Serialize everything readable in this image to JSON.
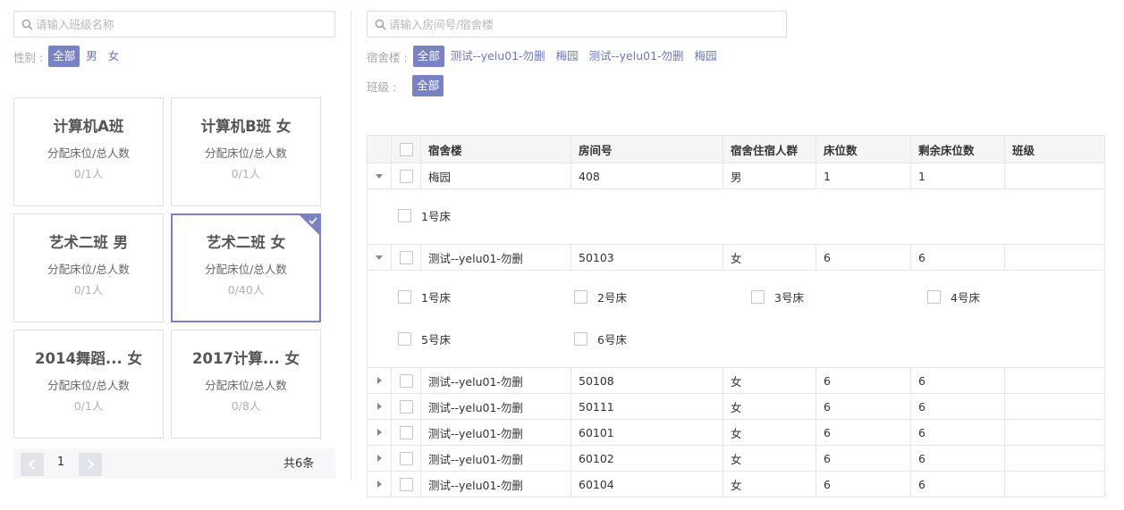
{
  "class_panel": {
    "search_placeholder": "请输入班级名称",
    "gender_label": "性别 :",
    "gender_options": [
      "全部",
      "男",
      "女"
    ],
    "classes": [
      {
        "name": "计算机A班",
        "sub": "分配床位/总人数",
        "count": "0/1人"
      },
      {
        "name": "计算机B班 女",
        "sub": "分配床位/总人数",
        "count": "0/1人"
      },
      {
        "name": "艺术二班 男",
        "sub": "分配床位/总人数",
        "count": "0/1人"
      },
      {
        "name": "艺术二班 女",
        "sub": "分配床位/总人数",
        "count": "0/40人"
      },
      {
        "name": "2014舞蹈... 女",
        "sub": "分配床位/总人数",
        "count": "0/1人"
      },
      {
        "name": "2017计算... 女",
        "sub": "分配床位/总人数",
        "count": "0/8人"
      }
    ],
    "pager": {
      "page": "1",
      "total": "共6条"
    }
  },
  "room_panel": {
    "search_placeholder": "请输入房间号/宿舍楼",
    "building_label": "宿舍楼 :",
    "building_options": [
      "全部",
      "测试--yelu01-勿删",
      "梅园",
      "测试--yelu01-勿删",
      "梅园"
    ],
    "class_label": "班级 :",
    "class_options": [
      "全部"
    ],
    "table": {
      "headers": [
        "宿舍楼",
        "房间号",
        "宿舍住宿人群",
        "床位数",
        "剩余床位数",
        "班级"
      ],
      "rows": [
        {
          "building": "梅园",
          "room": "408",
          "gender": "男",
          "beds": "1",
          "remaining": "1",
          "class": ""
        },
        {
          "building": "测试--yelu01-勿删",
          "room": "50103",
          "gender": "女",
          "beds": "6",
          "remaining": "6",
          "class": ""
        },
        {
          "building": "测试--yelu01-勿删",
          "room": "50108",
          "gender": "女",
          "beds": "6",
          "remaining": "6",
          "class": ""
        },
        {
          "building": "测试--yelu01-勿删",
          "room": "50111",
          "gender": "女",
          "beds": "6",
          "remaining": "6",
          "class": ""
        },
        {
          "building": "测试--yelu01-勿删",
          "room": "60101",
          "gender": "女",
          "beds": "6",
          "remaining": "6",
          "class": ""
        },
        {
          "building": "测试--yelu01-勿删",
          "room": "60102",
          "gender": "女",
          "beds": "6",
          "remaining": "6",
          "class": ""
        },
        {
          "building": "测试--yelu01-勿删",
          "room": "60104",
          "gender": "女",
          "beds": "6",
          "remaining": "6",
          "class": ""
        }
      ],
      "expanded_beds": {
        "row0": [
          "1号床"
        ],
        "row1": [
          "1号床",
          "2号床",
          "3号床",
          "4号床",
          "5号床",
          "6号床"
        ]
      }
    }
  },
  "colors": {
    "accent": "#7a82c6",
    "link": "#6c76bd"
  },
  "icons": {
    "search": "search-icon",
    "expand": "caret-down-icon",
    "collapse": "caret-right-icon",
    "prev": "chevron-left-icon",
    "next": "chevron-right-icon",
    "selected": "check-icon"
  }
}
